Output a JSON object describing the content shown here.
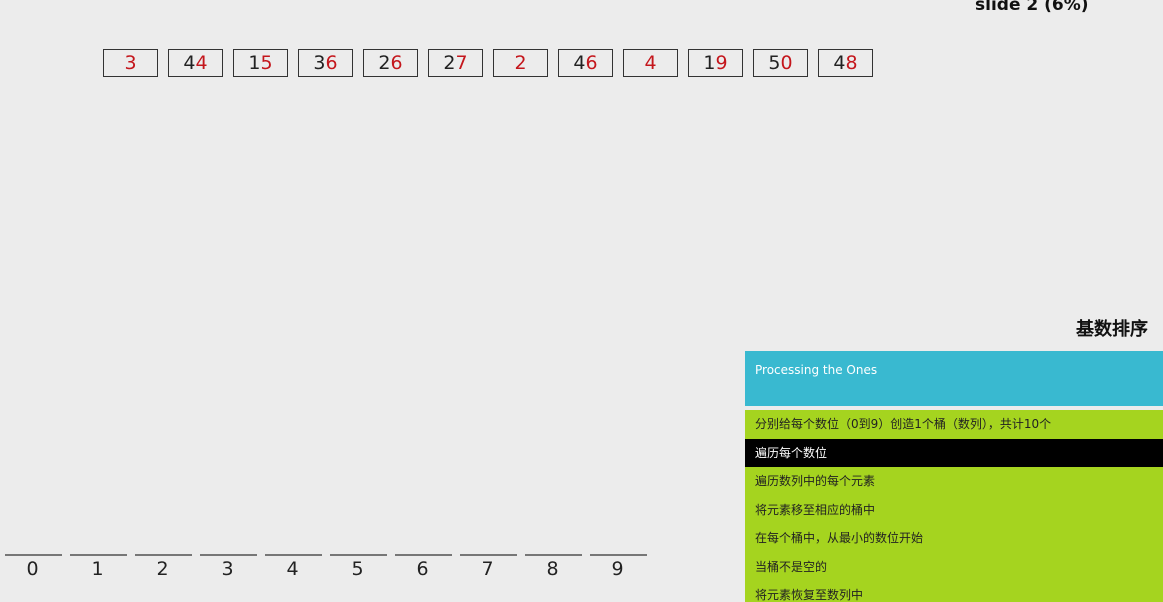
{
  "slide_label": "slide 2 (6%)",
  "array": [
    {
      "tens": "",
      "ones": "3"
    },
    {
      "tens": "4",
      "ones": "4"
    },
    {
      "tens": "1",
      "ones": "5"
    },
    {
      "tens": "3",
      "ones": "6"
    },
    {
      "tens": "2",
      "ones": "6"
    },
    {
      "tens": "2",
      "ones": "7"
    },
    {
      "tens": "",
      "ones": "2"
    },
    {
      "tens": "4",
      "ones": "6"
    },
    {
      "tens": "",
      "ones": "4"
    },
    {
      "tens": "1",
      "ones": "9"
    },
    {
      "tens": "5",
      "ones": "0"
    },
    {
      "tens": "4",
      "ones": "8"
    }
  ],
  "buckets": [
    "0",
    "1",
    "2",
    "3",
    "4",
    "5",
    "6",
    "7",
    "8",
    "9"
  ],
  "panel": {
    "title": "基数排序",
    "status": "Processing the Ones",
    "pseudocode": [
      "分别给每个数位（0到9）创造1个桶（数列），共计10个",
      "遍历每个数位",
      "遍历数列中的每个元素",
      "将元素移至相应的桶中",
      "在每个桶中，从最小的数位开始",
      "当桶不是空的",
      "将元素恢复至数列中"
    ],
    "active_line_index": 1
  },
  "colors": {
    "digit_highlight": "#c4161c",
    "status_bg": "#39b9d0",
    "pseudocode_bg": "#a5d41f",
    "active_line_bg": "#000000",
    "page_bg": "#ececec"
  }
}
